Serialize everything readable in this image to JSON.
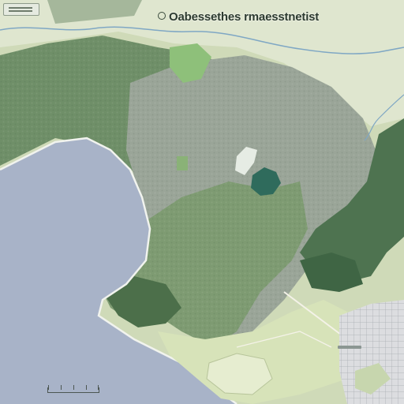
{
  "map": {
    "title": "Oabessethes rmaesstnetist",
    "colors": {
      "sea": "#a8b3c8",
      "lowland": "#d2deb8",
      "forest_light": "#8fa886",
      "forest_dark": "#4f7350",
      "upland_grey": "#9ea89d",
      "lake": "#2f6b5c",
      "river": "#7fa7c4",
      "urban": "#d9dadc",
      "meadow": "#8ec07a"
    }
  }
}
